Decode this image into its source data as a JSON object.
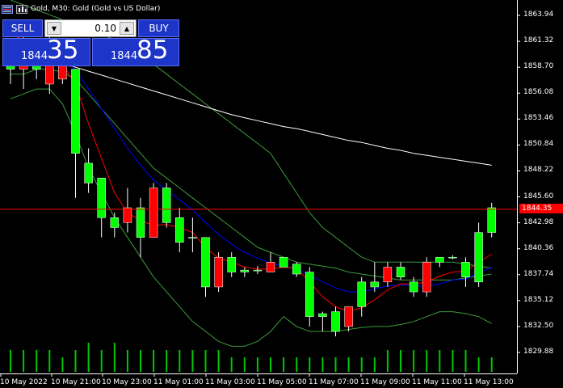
{
  "window": {
    "title": "Gold, M30:  Gold (Gold vs US Dollar)"
  },
  "trade_panel": {
    "sell_label": "SELL",
    "buy_label": "BUY",
    "lot_value": "0.10",
    "sell_price_small": "1844",
    "sell_price_big": "35",
    "buy_price_small": "1844",
    "buy_price_big": "85",
    "stepper_down_icon": "triangle-down",
    "stepper_up_icon": "triangle-up"
  },
  "price_axis": {
    "labels": [
      "1863.94",
      "1861.32",
      "1858.70",
      "1856.08",
      "1853.46",
      "1850.84",
      "1848.22",
      "1845.60",
      "1842.98",
      "1840.36",
      "1837.74",
      "1835.12",
      "1832.50",
      "1829.88"
    ],
    "current_price": "1844.35"
  },
  "time_axis": {
    "labels": [
      "10 May 2022",
      "10 May 21:00",
      "10 May 23:00",
      "11 May 01:00",
      "11 May 03:00",
      "11 May 05:00",
      "11 May 07:00",
      "11 May 09:00",
      "11 May 11:00",
      "11 May 13:00"
    ]
  },
  "colors": {
    "background": "#000000",
    "bull": "#00ff00",
    "bear": "#ff0000",
    "ma_fast": "#ff0000",
    "ma_mid": "#0000ff",
    "ma_slow": "#ffffff",
    "bands": "#3c9b3c",
    "volume": "#00c800",
    "current_line": "#ff0000",
    "panel": "#1d35c8"
  },
  "chart_data": {
    "type": "candlestick",
    "symbol": "Gold",
    "timeframe": "M30",
    "ylim": [
      1829.0,
      1865.0
    ],
    "candles": [
      {
        "o": 1858.5,
        "h": 1861.5,
        "l": 1857.0,
        "c": 1861.0
      },
      {
        "o": 1860.5,
        "h": 1862.0,
        "l": 1856.5,
        "c": 1858.5
      },
      {
        "o": 1858.5,
        "h": 1860.5,
        "l": 1857.5,
        "c": 1859.5
      },
      {
        "o": 1861.5,
        "h": 1862.5,
        "l": 1856.0,
        "c": 1857.0
      },
      {
        "o": 1859.0,
        "h": 1860.0,
        "l": 1857.0,
        "c": 1857.5
      },
      {
        "o": 1850.0,
        "h": 1858.5,
        "l": 1845.5,
        "c": 1858.5
      },
      {
        "o": 1847.0,
        "h": 1850.5,
        "l": 1846.0,
        "c": 1849.0
      },
      {
        "o": 1843.5,
        "h": 1847.5,
        "l": 1841.5,
        "c": 1847.5
      },
      {
        "o": 1842.5,
        "h": 1844.0,
        "l": 1841.5,
        "c": 1843.5
      },
      {
        "o": 1844.5,
        "h": 1846.5,
        "l": 1842.0,
        "c": 1843.0
      },
      {
        "o": 1841.5,
        "h": 1845.5,
        "l": 1839.5,
        "c": 1844.5
      },
      {
        "o": 1846.5,
        "h": 1847.0,
        "l": 1841.5,
        "c": 1841.5
      },
      {
        "o": 1843.0,
        "h": 1847.0,
        "l": 1842.5,
        "c": 1846.5
      },
      {
        "o": 1841.0,
        "h": 1844.5,
        "l": 1840.0,
        "c": 1843.5
      },
      {
        "o": 1841.5,
        "h": 1843.5,
        "l": 1840.0,
        "c": 1841.5
      },
      {
        "o": 1836.5,
        "h": 1841.5,
        "l": 1835.5,
        "c": 1841.5
      },
      {
        "o": 1839.5,
        "h": 1840.0,
        "l": 1836.0,
        "c": 1836.5
      },
      {
        "o": 1838.0,
        "h": 1840.0,
        "l": 1837.5,
        "c": 1839.5
      },
      {
        "o": 1838.0,
        "h": 1838.5,
        "l": 1837.5,
        "c": 1838.2
      },
      {
        "o": 1838.2,
        "h": 1838.6,
        "l": 1837.8,
        "c": 1838.2
      },
      {
        "o": 1839.0,
        "h": 1840.0,
        "l": 1838.0,
        "c": 1838.0
      },
      {
        "o": 1838.5,
        "h": 1839.5,
        "l": 1838.5,
        "c": 1839.5
      },
      {
        "o": 1837.8,
        "h": 1839.0,
        "l": 1837.5,
        "c": 1838.8
      },
      {
        "o": 1833.5,
        "h": 1838.5,
        "l": 1832.5,
        "c": 1838.0
      },
      {
        "o": 1833.5,
        "h": 1834.0,
        "l": 1832.0,
        "c": 1833.8
      },
      {
        "o": 1832.0,
        "h": 1834.5,
        "l": 1831.5,
        "c": 1834.0
      },
      {
        "o": 1834.5,
        "h": 1834.5,
        "l": 1832.0,
        "c": 1832.5
      },
      {
        "o": 1834.5,
        "h": 1837.5,
        "l": 1833.5,
        "c": 1837.0
      },
      {
        "o": 1836.5,
        "h": 1839.0,
        "l": 1836.0,
        "c": 1837.0
      },
      {
        "o": 1838.5,
        "h": 1839.0,
        "l": 1836.5,
        "c": 1837.0
      },
      {
        "o": 1837.5,
        "h": 1839.0,
        "l": 1837.2,
        "c": 1838.5
      },
      {
        "o": 1836.0,
        "h": 1837.5,
        "l": 1835.5,
        "c": 1837.0
      },
      {
        "o": 1839.0,
        "h": 1839.5,
        "l": 1835.5,
        "c": 1836.0
      },
      {
        "o": 1839.0,
        "h": 1839.5,
        "l": 1838.5,
        "c": 1839.5
      },
      {
        "o": 1839.5,
        "h": 1839.7,
        "l": 1839.3,
        "c": 1839.5
      },
      {
        "o": 1837.5,
        "h": 1839.5,
        "l": 1836.5,
        "c": 1839.0
      },
      {
        "o": 1837.0,
        "h": 1843.0,
        "l": 1836.5,
        "c": 1842.0
      },
      {
        "o": 1842.0,
        "h": 1845.0,
        "l": 1841.5,
        "c": 1844.5
      }
    ],
    "ma_fast": [
      1862.0,
      1861.5,
      1861.0,
      1860.0,
      1859.0,
      1857.0,
      1853.0,
      1849.5,
      1846.0,
      1844.0,
      1843.2,
      1842.7,
      1842.8,
      1842.5,
      1842.0,
      1840.5,
      1839.4,
      1839.0,
      1838.5,
      1838.3,
      1838.3,
      1838.5,
      1838.4,
      1837.0,
      1835.5,
      1834.5,
      1834.0,
      1834.4,
      1835.2,
      1836.2,
      1836.8,
      1836.8,
      1837.0,
      1837.6,
      1838.0,
      1838.1,
      1839.0,
      1839.8
    ],
    "ma_mid": [
      1861.0,
      1860.8,
      1860.5,
      1860.0,
      1859.5,
      1858.5,
      1856.5,
      1854.5,
      1852.5,
      1850.5,
      1848.8,
      1847.3,
      1846.3,
      1845.3,
      1844.3,
      1843.0,
      1841.8,
      1840.8,
      1840.0,
      1839.4,
      1838.9,
      1838.6,
      1838.3,
      1837.7,
      1837.0,
      1836.4,
      1836.0,
      1836.0,
      1836.3,
      1836.6,
      1836.7,
      1836.6,
      1836.6,
      1836.8,
      1837.2,
      1837.3,
      1837.9,
      1838.5
    ],
    "ma_slow": [
      1859.8,
      1859.6,
      1859.4,
      1859.2,
      1859.0,
      1858.7,
      1858.3,
      1857.9,
      1857.5,
      1857.1,
      1856.7,
      1856.3,
      1855.9,
      1855.5,
      1855.1,
      1854.7,
      1854.3,
      1853.9,
      1853.6,
      1853.3,
      1853.0,
      1852.7,
      1852.5,
      1852.2,
      1851.9,
      1851.6,
      1851.3,
      1851.1,
      1850.8,
      1850.5,
      1850.3,
      1850.0,
      1849.8,
      1849.6,
      1849.4,
      1849.2,
      1849.0,
      1848.8
    ],
    "band_upper": [
      1865.5,
      1865.0,
      1864.5,
      1864.0,
      1863.5,
      1863.0,
      1862.5,
      1862.0,
      1861.5,
      1861.0,
      1860.0,
      1859.0,
      1858.0,
      1857.0,
      1856.0,
      1855.0,
      1854.0,
      1853.0,
      1852.0,
      1851.0,
      1850.0,
      1848.0,
      1846.0,
      1844.0,
      1842.5,
      1841.5,
      1840.5,
      1839.5,
      1839.0,
      1839.0,
      1839.0,
      1839.0,
      1839.0,
      1839.0,
      1839.0,
      1838.8,
      1838.6,
      1838.4
    ],
    "band_mid": [
      1858.0,
      1858.0,
      1858.5,
      1858.5,
      1858.2,
      1857.5,
      1856.0,
      1854.5,
      1853.0,
      1851.5,
      1850.0,
      1848.5,
      1847.5,
      1846.5,
      1845.5,
      1844.5,
      1843.5,
      1842.5,
      1841.5,
      1840.5,
      1840.0,
      1839.5,
      1839.0,
      1838.8,
      1838.6,
      1838.4,
      1838.0,
      1837.8,
      1837.6,
      1837.4,
      1837.2,
      1837.2,
      1837.2,
      1837.2,
      1837.2,
      1837.4,
      1837.6,
      1837.8
    ],
    "band_lower": [
      1855.5,
      1856.0,
      1856.5,
      1856.5,
      1855.0,
      1852.0,
      1848.5,
      1846.0,
      1843.5,
      1841.5,
      1839.5,
      1837.5,
      1836.0,
      1834.5,
      1833.0,
      1832.0,
      1831.0,
      1830.5,
      1830.5,
      1831.0,
      1832.0,
      1833.5,
      1832.5,
      1832.0,
      1832.0,
      1832.0,
      1832.2,
      1832.4,
      1832.5,
      1832.5,
      1832.7,
      1833.0,
      1833.5,
      1834.0,
      1834.0,
      1833.8,
      1833.5,
      1832.8
    ],
    "volume": [
      3,
      3,
      3,
      3,
      2,
      3,
      4,
      3,
      4,
      3,
      3,
      3,
      3,
      3,
      3,
      3,
      3,
      2,
      2,
      2,
      2,
      2,
      2,
      2,
      2,
      2,
      2,
      2,
      2,
      3,
      3,
      3,
      3,
      3,
      3,
      3,
      2,
      2
    ]
  }
}
